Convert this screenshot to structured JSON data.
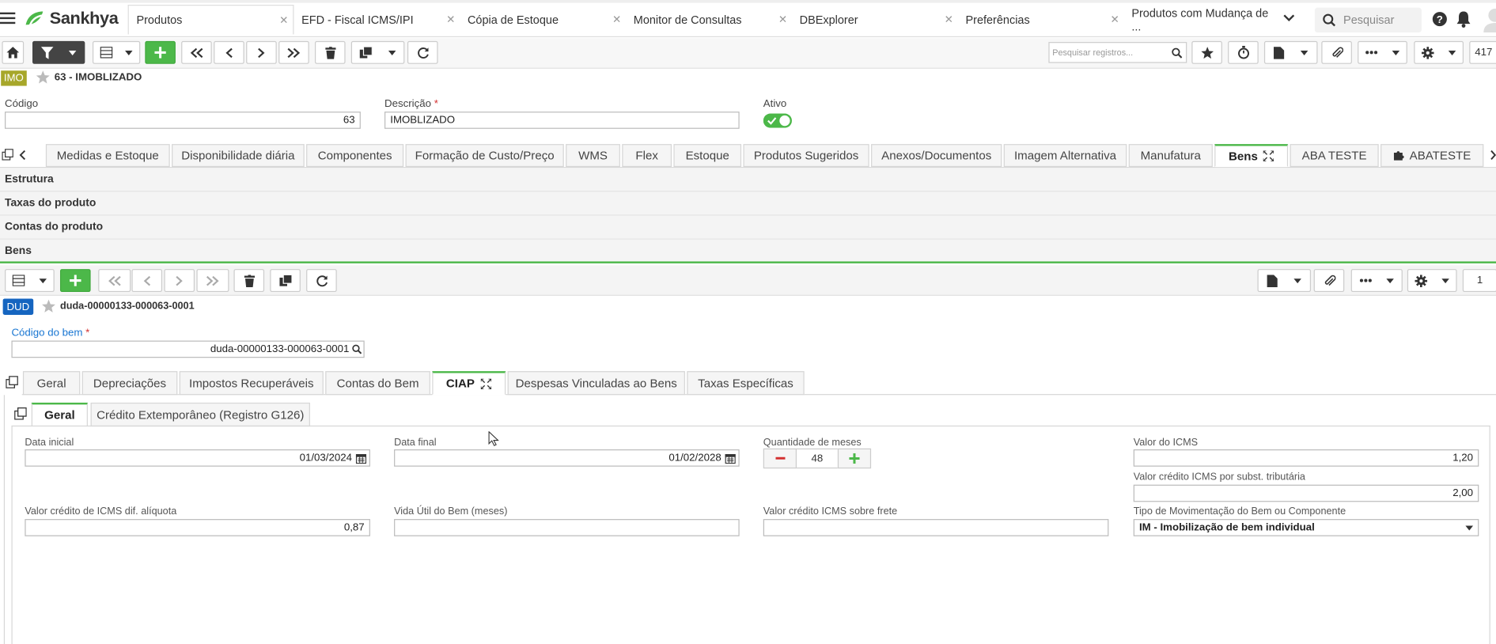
{
  "app": {
    "brand": "Sankhya"
  },
  "tabs": [
    {
      "label": "Produtos"
    },
    {
      "label": "EFD - Fiscal ICMS/IPI"
    },
    {
      "label": "Cópia de Estoque"
    },
    {
      "label": "Monitor de Consultas"
    },
    {
      "label": "DBExplorer"
    },
    {
      "label": "Preferências"
    },
    {
      "label": "Produtos com Mudança de ..."
    }
  ],
  "search": {
    "placeholder": "Pesquisar"
  },
  "toolbar": {
    "search_placeholder": "Pesquisar registros...",
    "record_count": "417"
  },
  "record": {
    "badge": "IMO",
    "title": "63 - IMOBLIZADO"
  },
  "fields": {
    "codigo_label": "Código",
    "codigo_value": "63",
    "descricao_label": "Descrição",
    "descricao_value": "IMOBLIZADO",
    "ativo_label": "Ativo"
  },
  "form_tabs": [
    "Medidas e Estoque",
    "Disponibilidade diária",
    "Componentes",
    "Formação de Custo/Preço",
    "WMS",
    "Flex",
    "Estoque",
    "Produtos Sugeridos",
    "Anexos/Documentos",
    "Imagem Alternativa",
    "Manufatura",
    "Bens",
    "ABA TESTE",
    "ABATESTE"
  ],
  "sections": [
    "Estrutura",
    "Taxas do produto",
    "Contas do produto",
    "Bens"
  ],
  "sub_toolbar": {
    "page": "1"
  },
  "sub_record": {
    "badge": "DUD",
    "title": "duda-00000133-000063-0001"
  },
  "bem": {
    "label": "Código do bem",
    "value": "duda-00000133-000063-0001"
  },
  "bem_tabs": [
    "Geral",
    "Depreciações",
    "Impostos Recuperáveis",
    "Contas do Bem",
    "CIAP",
    "Despesas Vinculadas ao Bens",
    "Taxas Específicas"
  ],
  "ciap_tabs": [
    "Geral",
    "Crédito Extemporâneo (Registro G126)"
  ],
  "ciap": {
    "data_inicial_label": "Data inicial",
    "data_inicial": "01/03/2024",
    "data_final_label": "Data final",
    "data_final": "01/02/2028",
    "qtd_meses_label": "Quantidade de meses",
    "qtd_meses": "48",
    "valor_icms_label": "Valor do ICMS",
    "valor_icms": "1,20",
    "valor_credito_subst_label": "Valor crédito ICMS por subst. tributária",
    "valor_credito_subst": "2,00",
    "valor_credito_dif_label": "Valor crédito de ICMS dif. alíquota",
    "valor_credito_dif": "0,87",
    "vida_util_label": "Vida Útil do Bem (meses)",
    "vida_util": "",
    "valor_credito_frete_label": "Valor crédito ICMS sobre frete",
    "valor_credito_frete": "",
    "tipo_mov_label": "Tipo de Movimentação do Bem ou Componente",
    "tipo_mov": "IM - Imobilização de bem individual"
  },
  "colors": {
    "accent": "#4cb849",
    "imo_badge": "#a7a72a",
    "dud_badge": "#1565c0",
    "link": "#1976d2"
  }
}
